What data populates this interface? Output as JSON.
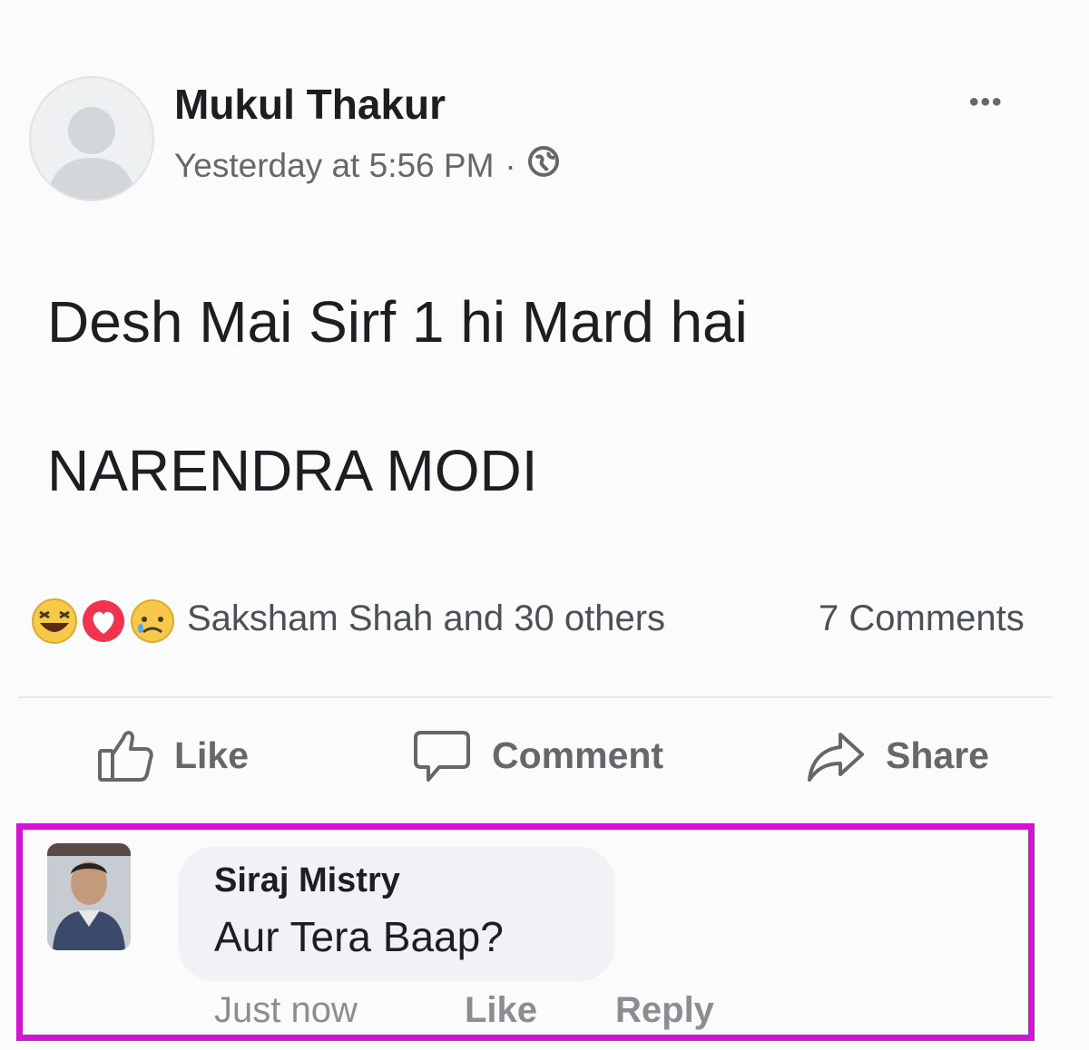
{
  "post": {
    "author": "Mukul Thakur",
    "timestamp": "Yesterday at 5:56 PM",
    "separator": "·",
    "privacy_icon": "globe-icon",
    "menu_icon": "more-options-icon",
    "menu_label": "•••",
    "text_line1": "Desh Mai Sirf 1 hi Mard hai",
    "text_line2": "NARENDRA MODI"
  },
  "engagement": {
    "reaction_icons": [
      "haha-icon",
      "love-icon",
      "sad-icon"
    ],
    "reactors": "Saksham Shah and 30 others",
    "comments_count": "7 Comments"
  },
  "actions": {
    "like": "Like",
    "comment": "Comment",
    "share": "Share"
  },
  "comment": {
    "author": "Siraj Mistry",
    "text": "Aur Tera Baap?",
    "time": "Just now",
    "like": "Like",
    "reply": "Reply"
  },
  "colors": {
    "highlight_border": "#d115d3",
    "primary_text": "#1c1e21",
    "secondary_text": "#65676b",
    "bubble_bg": "#f0f2f5"
  }
}
